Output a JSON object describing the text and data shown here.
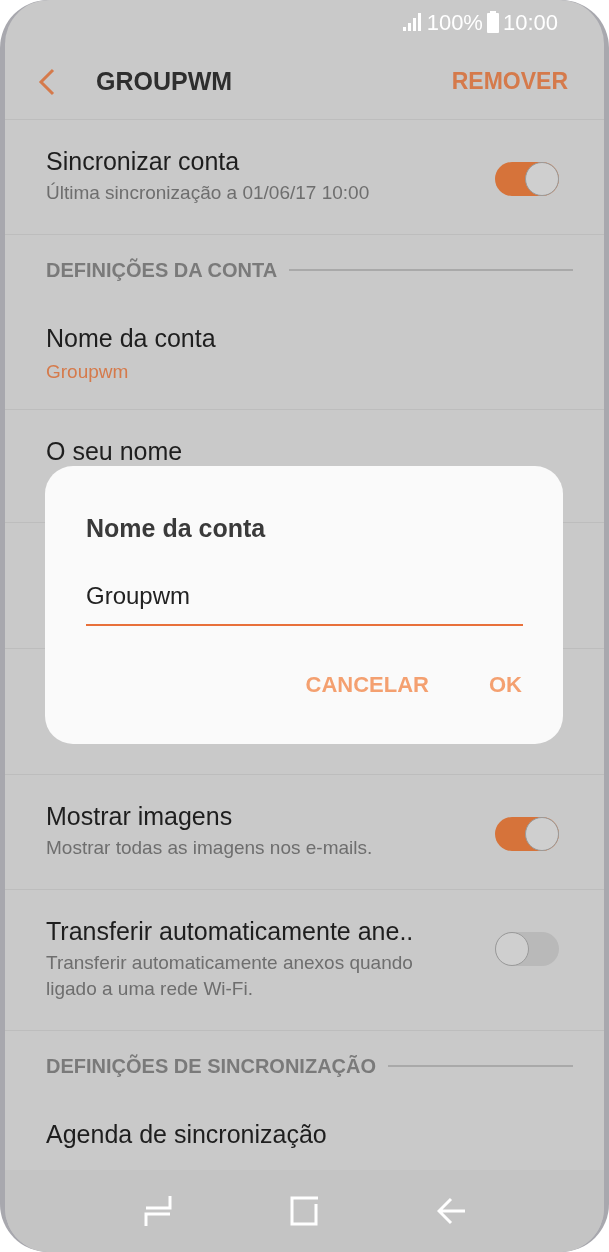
{
  "status_bar": {
    "battery": "100%",
    "time": "10:00"
  },
  "header": {
    "title": "GROUPWM",
    "action": "REMOVER"
  },
  "rows": [
    {
      "kind": "toggle",
      "title": "Sincronizar conta",
      "subtitle": "Última sincronização a 01/06/17  10:00",
      "on": true
    },
    {
      "kind": "section",
      "title": "DEFINIÇÕES DA CONTA"
    },
    {
      "kind": "value",
      "title": "Nome da conta",
      "value": "Groupwm"
    },
    {
      "kind": "value",
      "title": "O seu nome"
    },
    {
      "kind": "covered"
    },
    {
      "kind": "covered"
    },
    {
      "kind": "toggle",
      "title": "Mostrar imagens",
      "subtitle": "Mostrar todas as imagens nos e-mails.",
      "on": true
    },
    {
      "kind": "toggle",
      "title": "Transferir automaticamente ane..",
      "subtitle": "Transferir automaticamente anexos quando ligado a uma rede Wi-Fi.",
      "on": false
    },
    {
      "kind": "section",
      "title": "DEFINIÇÕES DE SINCRONIZAÇÃO"
    },
    {
      "kind": "value",
      "title": "Agenda de sincronização"
    }
  ],
  "dialog": {
    "title": "Nome da conta",
    "value": "Groupwm",
    "buttons": [
      "CANCELAR",
      "OK"
    ]
  }
}
